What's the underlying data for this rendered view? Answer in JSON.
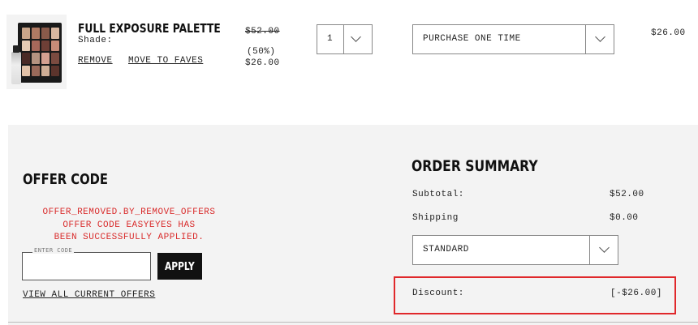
{
  "product": {
    "name": "FULL EXPOSURE PALETTE",
    "shade_label": "Shade:",
    "remove_label": "REMOVE",
    "move_label": "MOVE TO FAVES",
    "original_price": "$52.00",
    "discount_percent": "(50%)",
    "sale_price": "$26.00",
    "quantity": "1",
    "purchase_option": "PURCHASE ONE TIME",
    "line_total": "$26.00",
    "pan_colors": [
      "#c9a58a",
      "#b07a63",
      "#8a5a4a",
      "#d9b7a0",
      "#e6cbb4",
      "#a8685a",
      "#6e3f36",
      "#c78b78",
      "#4a2a25",
      "#b59380",
      "#d4a090",
      "#7b4b40",
      "#e2c2a8",
      "#9a6a5a",
      "#cfae96",
      "#5c342c"
    ]
  },
  "offer": {
    "title": "OFFER CODE",
    "message_line1": "OFFER_REMOVED.BY_REMOVE_OFFERS",
    "message_line2": "OFFER CODE EASYEYES HAS",
    "message_line3": "BEEN SUCCESSFULLY APPLIED.",
    "input_label": "ENTER CODE",
    "input_value": "",
    "apply_label": "APPLY",
    "view_offers_label": "VIEW ALL CURRENT OFFERS"
  },
  "summary": {
    "title": "ORDER SUMMARY",
    "subtotal_label": "Subtotal:",
    "subtotal_value": "$52.00",
    "shipping_label": "Shipping",
    "shipping_value": "$0.00",
    "shipping_method": "STANDARD",
    "discount_label": "Discount:",
    "discount_value": "[-$26.00]"
  },
  "colors": {
    "error_text": "#d92c2c",
    "highlight_border": "#e0282b",
    "panel_bg": "#f3f3f3"
  }
}
